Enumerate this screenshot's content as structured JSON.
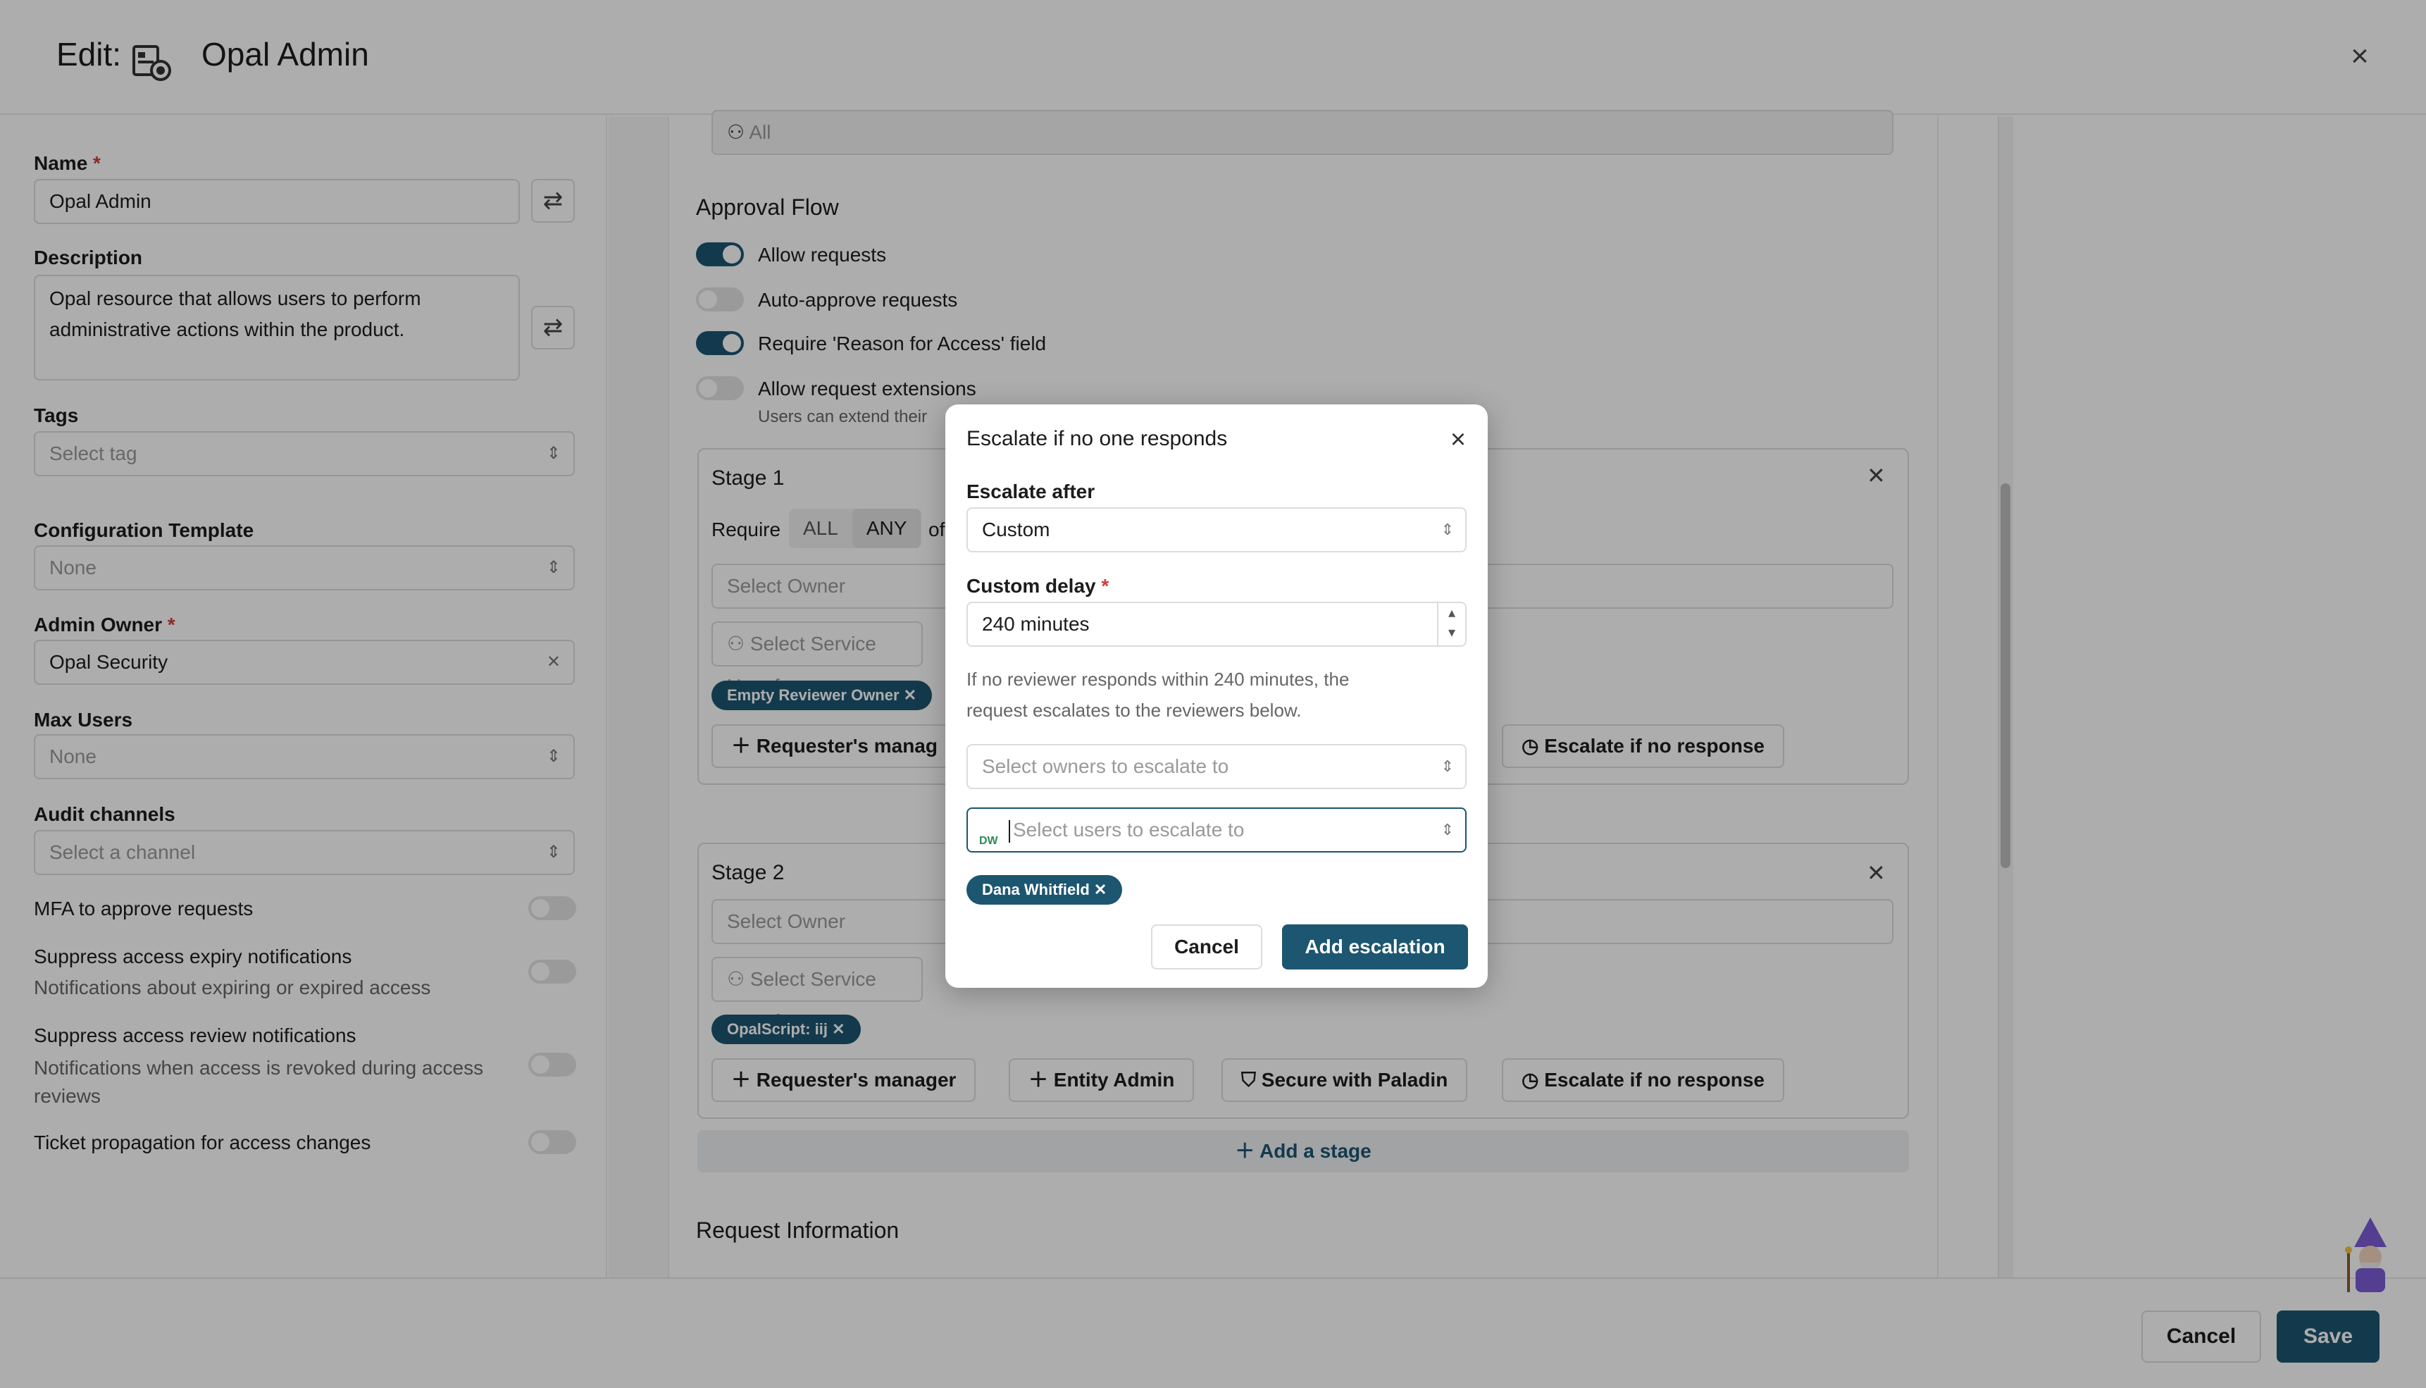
{
  "header": {
    "title_prefix": "Edit:",
    "title": "Opal Admin",
    "close_icon": "close-icon"
  },
  "left_panel": {
    "name_label": "Name",
    "name_value": "Opal Admin",
    "description_label": "Description",
    "description_value": "Opal resource that allows users to perform administrative actions within the product.",
    "tags_label": "Tags",
    "tags_placeholder": "Select tag",
    "config_template_label": "Configuration Template",
    "config_template_value": "None",
    "admin_owner_label": "Admin Owner",
    "admin_owner_value": "Opal Security",
    "max_users_label": "Max Users",
    "max_users_value": "None",
    "audit_channels_label": "Audit channels",
    "audit_channels_placeholder": "Select a channel",
    "mfa_label": "MFA to approve requests",
    "suppress_expiry_label": "Suppress access expiry notifications",
    "suppress_expiry_sub": "Notifications about expiring or expired access",
    "suppress_review_label": "Suppress access review notifications",
    "suppress_review_sub": "Notifications when access is revoked during access reviews",
    "ticket_label": "Ticket propagation for access changes"
  },
  "main": {
    "top_select_placeholder": "All",
    "approval_flow_title": "Approval Flow",
    "allow_requests": "Allow requests",
    "auto_approve": "Auto-approve requests",
    "require_reason": "Require 'Reason for Access' field",
    "allow_extensions": "Allow request extensions",
    "extensions_sub": "Users can extend their",
    "stage1_title": "Stage 1",
    "require_label": "Require",
    "seg_all": "ALL",
    "seg_any": "ANY",
    "of_label": "of",
    "select_owner": "Select Owner",
    "select_service_user": "Select Service User f",
    "stage1_chip": "Empty Reviewer Owner",
    "requesters_manager_clipped": "Requester's manag",
    "escalate_btn": "Escalate if no response",
    "stage2_title": "Stage 2",
    "select_owner2": "Select Owner",
    "select_service_user2": "Select Service User f",
    "stage2_chip": "OpalScript: iij",
    "requesters_manager": "Requester's manager",
    "entity_admin": "Entity Admin",
    "secure_paladin": "Secure with Paladin",
    "escalate_btn2": "Escalate if no response",
    "add_stage": "Add a stage",
    "request_info_title": "Request Information"
  },
  "footer": {
    "cancel": "Cancel",
    "save": "Save"
  },
  "modal": {
    "title": "Escalate if no one responds",
    "escalate_after_label": "Escalate after",
    "escalate_after_value": "Custom",
    "custom_delay_label": "Custom delay",
    "custom_delay_value": "240 minutes",
    "help_text": "If no reviewer responds within 240 minutes, the request escalates to the reviewers below.",
    "owners_placeholder": "Select owners to escalate to",
    "users_placeholder": "Select users to escalate to",
    "users_prefix": "DW",
    "selected_user_chip": "Dana Whitfield",
    "cancel": "Cancel",
    "add": "Add escalation"
  },
  "colors": {
    "accent": "#1c5670",
    "required": "#d23b3b"
  }
}
